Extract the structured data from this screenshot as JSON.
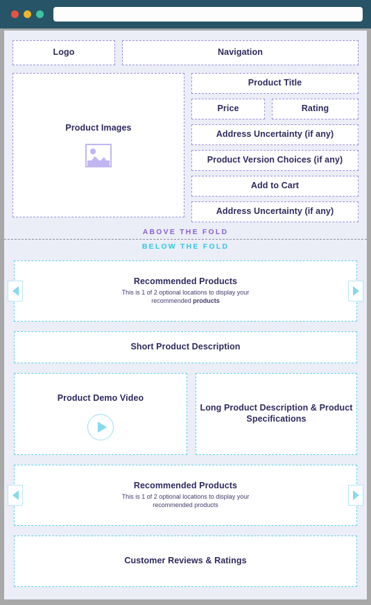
{
  "browser": {
    "url_value": "",
    "url_placeholder": "",
    "traffic_lights": [
      {
        "name": "close",
        "color": "#e8533f"
      },
      {
        "name": "minimize",
        "color": "#f0b429"
      },
      {
        "name": "maximize",
        "color": "#3cc4a0"
      }
    ],
    "chrome_color": "#275467"
  },
  "colors": {
    "page_background": "#ebedf7",
    "above_fold_accent": "#8a5fd8",
    "below_fold_accent": "#2ec8e6",
    "purple_dashed_border": "#9a8ee0",
    "cyan_dashed_border": "#5fd2ea",
    "heading_text": "#2e2a5e"
  },
  "header": {
    "logo_label": "Logo",
    "navigation_label": "Navigation"
  },
  "hero": {
    "product_images_label": "Product Images",
    "image_placeholder_icon": "image-placeholder-icon",
    "product_title_label": "Product Title",
    "price_label": "Price",
    "rating_label": "Rating",
    "address_uncertainty_top_label": "Address Uncertainty (if any)",
    "product_version_label": "Product Version Choices (if any)",
    "add_to_cart_label": "Add to Cart",
    "address_uncertainty_bottom_label": "Address Uncertainty (if any)"
  },
  "fold": {
    "above_label": "ABOVE THE FOLD",
    "below_label": "BELOW THE FOLD"
  },
  "below_fold": {
    "recommended_top": {
      "title": "Recommended Products",
      "subtitle_plain": "This is 1 of 2 optional locations to display your recommended ",
      "subtitle_bold": "products",
      "prev_icon": "chevron-left-icon",
      "next_icon": "chevron-right-icon"
    },
    "short_description_label": "Short Product Description",
    "demo_video": {
      "label": "Product Demo Video",
      "play_icon": "play-icon"
    },
    "long_description_label": "Long Product Description & Product Specifications",
    "recommended_bottom": {
      "title": "Recommended Products",
      "subtitle_plain": "This is 1 of 2 optional locations to display your recommended products",
      "subtitle_bold": "",
      "prev_icon": "chevron-left-icon",
      "next_icon": "chevron-right-icon"
    },
    "reviews_label": "Customer Reviews & Ratings"
  }
}
